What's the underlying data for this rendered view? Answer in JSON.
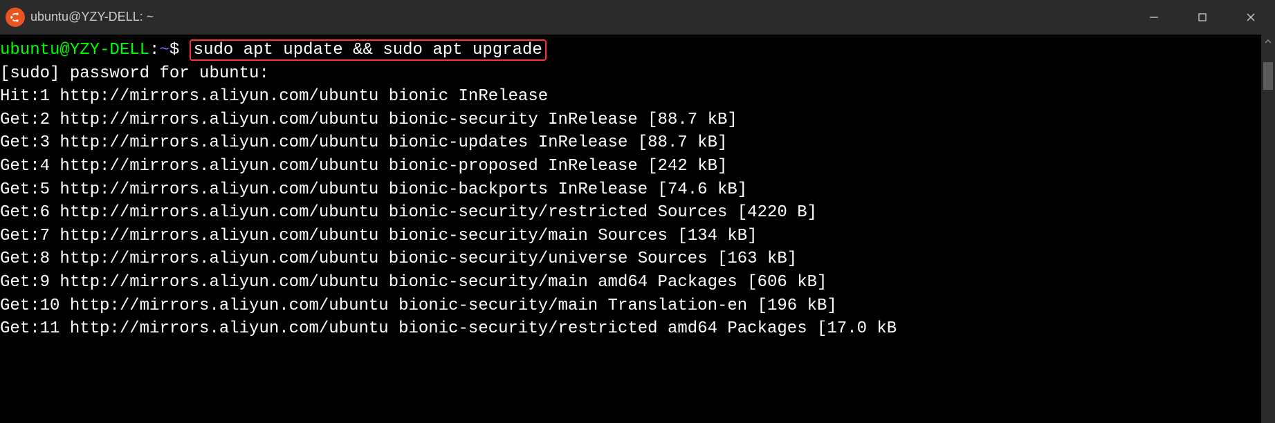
{
  "titlebar": {
    "title": "ubuntu@YZY-DELL: ~"
  },
  "prompt": {
    "user_host": "ubuntu@YZY-DELL",
    "colon": ":",
    "path": "~",
    "symbol": "$"
  },
  "command": "sudo apt update && sudo apt upgrade",
  "output": {
    "lines": [
      "[sudo] password for ubuntu:",
      "Hit:1 http://mirrors.aliyun.com/ubuntu bionic InRelease",
      "Get:2 http://mirrors.aliyun.com/ubuntu bionic-security InRelease [88.7 kB]",
      "Get:3 http://mirrors.aliyun.com/ubuntu bionic-updates InRelease [88.7 kB]",
      "Get:4 http://mirrors.aliyun.com/ubuntu bionic-proposed InRelease [242 kB]",
      "Get:5 http://mirrors.aliyun.com/ubuntu bionic-backports InRelease [74.6 kB]",
      "Get:6 http://mirrors.aliyun.com/ubuntu bionic-security/restricted Sources [4220 B]",
      "Get:7 http://mirrors.aliyun.com/ubuntu bionic-security/main Sources [134 kB]",
      "Get:8 http://mirrors.aliyun.com/ubuntu bionic-security/universe Sources [163 kB]",
      "Get:9 http://mirrors.aliyun.com/ubuntu bionic-security/main amd64 Packages [606 kB]",
      "Get:10 http://mirrors.aliyun.com/ubuntu bionic-security/main Translation-en [196 kB]",
      "Get:11 http://mirrors.aliyun.com/ubuntu bionic-security/restricted amd64 Packages [17.0 kB"
    ]
  }
}
